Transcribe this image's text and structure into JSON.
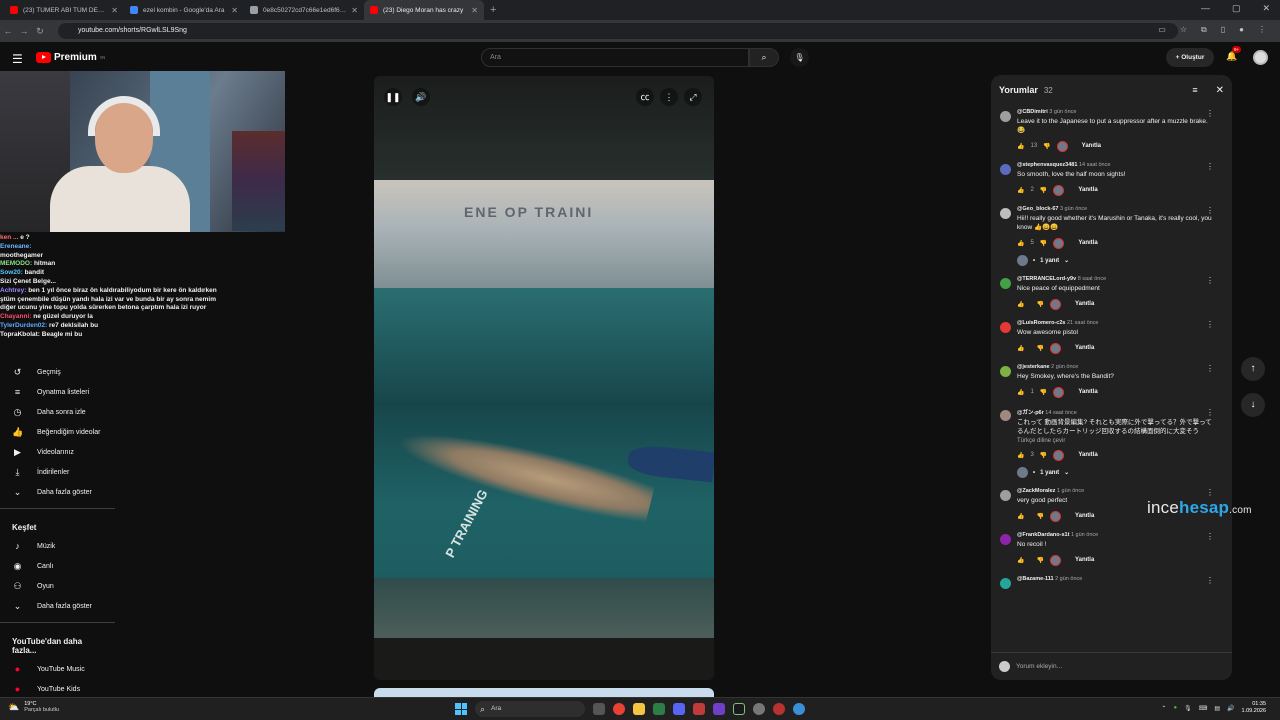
{
  "browser": {
    "tabs": [
      {
        "title": "(23) TÜMER ABİ TÜM DELİRME",
        "favicon_color": "#ff0000",
        "active": false
      },
      {
        "title": "ezel kombin - Google'da Ara",
        "favicon_color": "#4285f4",
        "active": false
      },
      {
        "title": "0e8c50272cd7c66e1ed6f6191",
        "favicon_color": "#9aa0a6",
        "active": false
      },
      {
        "title": "(23) Diego Moran has crazy",
        "favicon_color": "#ff0000",
        "active": true
      }
    ],
    "new_tab": "+",
    "url": "youtube.com/shorts/RGwlLSL9Sng"
  },
  "youtube": {
    "logo_text": "Premium",
    "logo_sup": "TR",
    "search_placeholder": "Ara",
    "create_label": "Oluştur",
    "notif_badge": "9+"
  },
  "chat": [
    {
      "user": "ken ...",
      "user_color": "#ff6d6d",
      "msg": "e ?"
    },
    {
      "user": "Ereneane:",
      "user_color": "#70b6ff",
      "msg": ""
    },
    {
      "user": "",
      "user_color": "#f1f1f1",
      "msg": "moothegamer"
    },
    {
      "user": "MEMODO:",
      "user_color": "#8be08b",
      "msg": "hitman"
    },
    {
      "user": "Sow20:",
      "user_color": "#58c6ff",
      "msg": "bandit"
    },
    {
      "user": "",
      "user_color": "#f1f1f1",
      "msg": "Sizi Çenet Belge..."
    },
    {
      "user": "Achtrey:",
      "user_color": "#9b8cff",
      "msg": "ben 1 yıl önce biraz ön kaldırabiliyodum bir kere ön kaldırken ştüm çenembile düşün yandı hala izi var ve bunda bir ay sonra nemim diğer ucunu yine topu yolda sürerken betona çarptım hala izi ruyor"
    },
    {
      "user": "Chayanni:",
      "user_color": "#ff4d6d",
      "msg": "ne güzel duruyor la"
    },
    {
      "user": "TylerDurden02:",
      "user_color": "#5aa9ff",
      "msg": "re7 deklsilah bu"
    },
    {
      "user": "TopraKbolat:",
      "user_color": "#f1f1f1",
      "msg": "Beagle mi bu"
    }
  ],
  "sidebar": {
    "you_items": [
      {
        "label": "Geçmiş",
        "icon": "history-icon",
        "glyph": "↺"
      },
      {
        "label": "Oynatma listeleri",
        "icon": "playlist-icon",
        "glyph": "≡"
      },
      {
        "label": "Daha sonra izle",
        "icon": "clock-icon",
        "glyph": "◷"
      },
      {
        "label": "Beğendiğim videolar",
        "icon": "thumbs-up-icon",
        "glyph": "👍"
      },
      {
        "label": "Videolarınız",
        "icon": "video-icon",
        "glyph": "▶"
      },
      {
        "label": "İndirilenler",
        "icon": "download-icon",
        "glyph": "⤓"
      },
      {
        "label": "Daha fazla göster",
        "icon": "chevron-down-icon",
        "glyph": "⌄"
      }
    ],
    "explore_title": "Keşfet",
    "explore_items": [
      {
        "label": "Müzik",
        "icon": "music-icon",
        "glyph": "♪"
      },
      {
        "label": "Canlı",
        "icon": "live-icon",
        "glyph": "◉"
      },
      {
        "label": "Oyun",
        "icon": "gamepad-icon",
        "glyph": "⚇"
      },
      {
        "label": "Daha fazla göster",
        "icon": "chevron-down-icon",
        "glyph": "⌄"
      }
    ],
    "more_title": "YouTube'dan daha fazla...",
    "more_items": [
      {
        "label": "YouTube Music",
        "icon": "yt-music-icon",
        "glyph": "●"
      },
      {
        "label": "YouTube Kids",
        "icon": "yt-kids-icon",
        "glyph": "●"
      }
    ]
  },
  "video": {
    "lane_text": "P TRAINING",
    "window_text": "ENE OP TRAINI"
  },
  "comments": {
    "title": "Yorumlar",
    "count": "32",
    "input_placeholder": "Yorum ekleyin...",
    "reply_label": "Yanıtla",
    "items": [
      {
        "user": "@CBDimitri",
        "time": "3 gün önce",
        "text": "Leave it to the Japanese to put a suppressor after a muzzle brake. 😂",
        "likes": "13",
        "avatar_color": "#9e9e9e",
        "replies": ""
      },
      {
        "user": "@stephenvasquez3481",
        "time": "14 saat önce",
        "text": "So smooth, love the half moon sights!",
        "likes": "2",
        "avatar_color": "#5c6bc0",
        "replies": ""
      },
      {
        "user": "@Geo_block-67",
        "time": "3 gün önce",
        "text": "Hii!! really good whether it's Marushin or Tanaka, it's really cool, you know 👍😄😄",
        "likes": "5",
        "avatar_color": "#bdbdbd",
        "replies": "1 yanıt"
      },
      {
        "user": "@TERRANCELord-y9v",
        "time": "8 saat önce",
        "text": "Nice peace of equippedment",
        "likes": "",
        "avatar_color": "#43a047",
        "replies": ""
      },
      {
        "user": "@LuisRomero-c2s",
        "time": "21 saat önce",
        "text": "Wow awesome  pistol",
        "likes": "",
        "avatar_color": "#e53935",
        "replies": ""
      },
      {
        "user": "@jesterkane",
        "time": "2 gün önce",
        "text": "Hey Smokey, where's the Bandit?",
        "likes": "1",
        "avatar_color": "#7cb342",
        "replies": ""
      },
      {
        "user": "@ガン-p6r",
        "time": "14 saat önce",
        "text": "これって 動画背景編集? それとも実際に外で撃ってる？外で撃ってるんだとしたらカートリッジ回収するの結構面倒的に大変そう",
        "translate": "Türkçe diline çevir",
        "likes": "3",
        "avatar_color": "#a1887f",
        "replies": "1 yanıt"
      },
      {
        "user": "@ZackMoralez",
        "time": "1 gün önce",
        "text": "very good perfect",
        "likes": "",
        "avatar_color": "#9e9e9e",
        "replies": ""
      },
      {
        "user": "@FrankDardano-s1t",
        "time": "1 gün önce",
        "text": "No recoil !",
        "likes": "",
        "avatar_color": "#8e24aa",
        "replies": ""
      },
      {
        "user": "@Bazame-111",
        "time": "2 gün önce",
        "text": "",
        "likes": "",
        "avatar_color": "#26a69a",
        "replies": ""
      }
    ]
  },
  "watermark": {
    "a": "ince",
    "b": "hesap",
    "c": ".com"
  },
  "taskbar": {
    "temp": "19°C",
    "weather": "Parçalı bulutlu",
    "search": "Ara",
    "time": "01:35",
    "date": "1.09.2026"
  }
}
